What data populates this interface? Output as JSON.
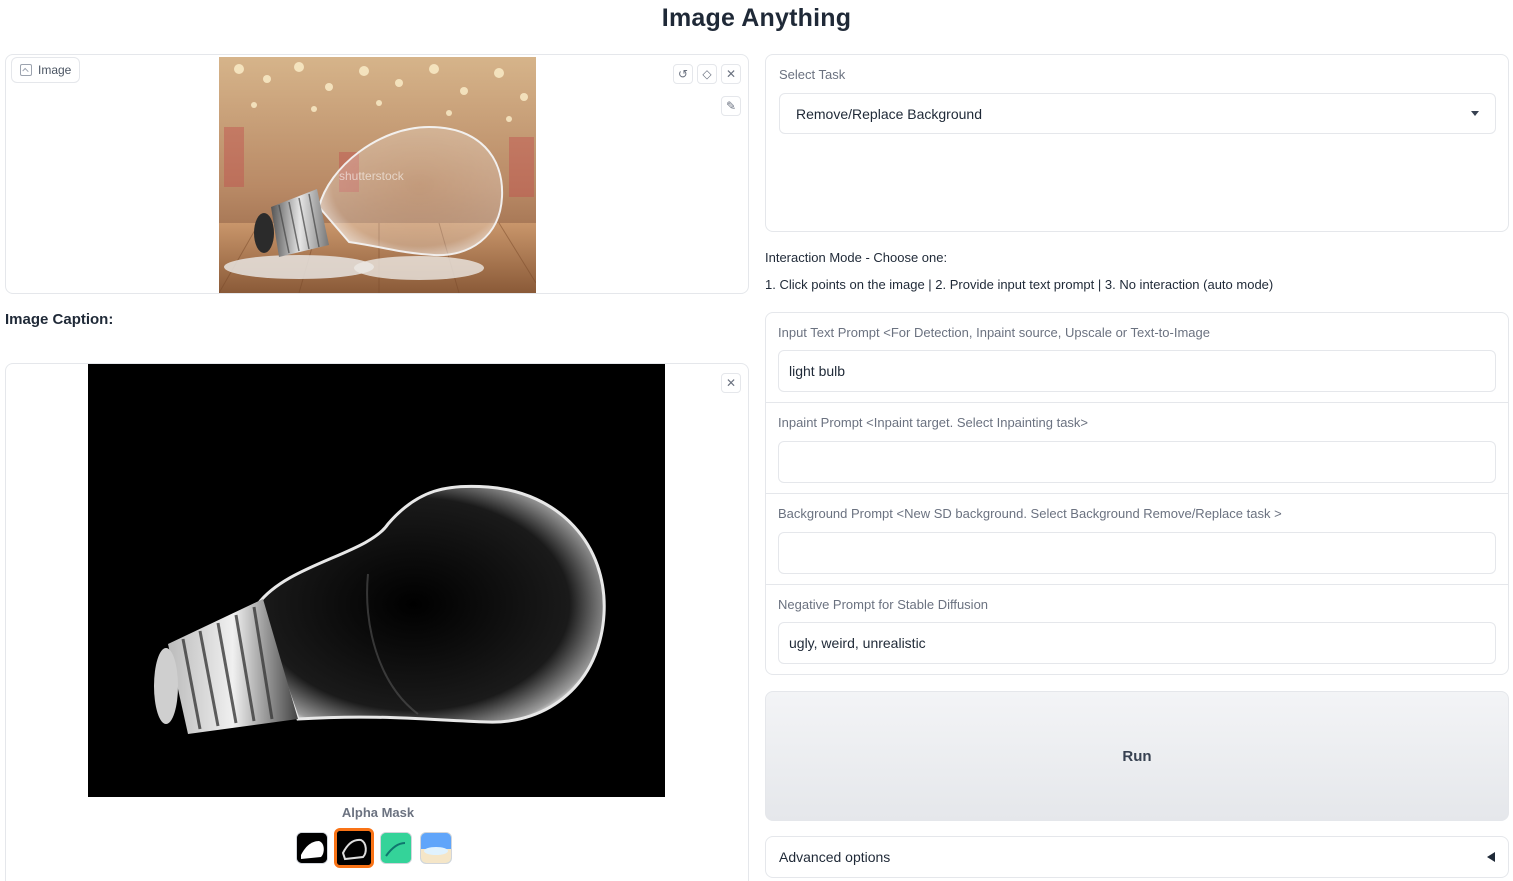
{
  "app": {
    "title": "Image Anything"
  },
  "input_image": {
    "tag_label": "Image",
    "watermark_text": "shutterstock",
    "tools": [
      "undo-icon",
      "eraser-icon",
      "close-icon",
      "brush-icon"
    ]
  },
  "caption": {
    "label": "Image Caption:"
  },
  "output_gallery": {
    "caption": "Alpha Mask",
    "thumbnails": [
      "mask-black-white",
      "alpha-mask",
      "green-overlay",
      "new-background"
    ],
    "selected_index": 1,
    "close_icon": "close-icon"
  },
  "task": {
    "label": "Select Task",
    "selected": "Remove/Replace Background"
  },
  "interaction": {
    "title": "Interaction Mode - Choose one:",
    "description": "1. Click points on the image | 2. Provide input text prompt | 3. No interaction (auto mode)"
  },
  "prompts": {
    "input_text": {
      "label": "Input Text Prompt <For Detection, Inpaint source, Upscale or Text-to-Image",
      "value": "light bulb"
    },
    "inpaint": {
      "label": "Inpaint Prompt <Inpaint target. Select Inpainting task>",
      "value": ""
    },
    "background": {
      "label": "Background Prompt <New SD background. Select Background Remove/Replace task >",
      "value": ""
    },
    "negative": {
      "label": "Negative Prompt for Stable Diffusion",
      "value": "ugly, weird, unrealistic"
    }
  },
  "actions": {
    "run_label": "Run",
    "advanced_label": "Advanced options"
  },
  "colors": {
    "accent_selected": "#f97316",
    "border": "#e5e7eb",
    "run_button_bg": "#e5e7eb",
    "thumb_green": "#34d399"
  }
}
